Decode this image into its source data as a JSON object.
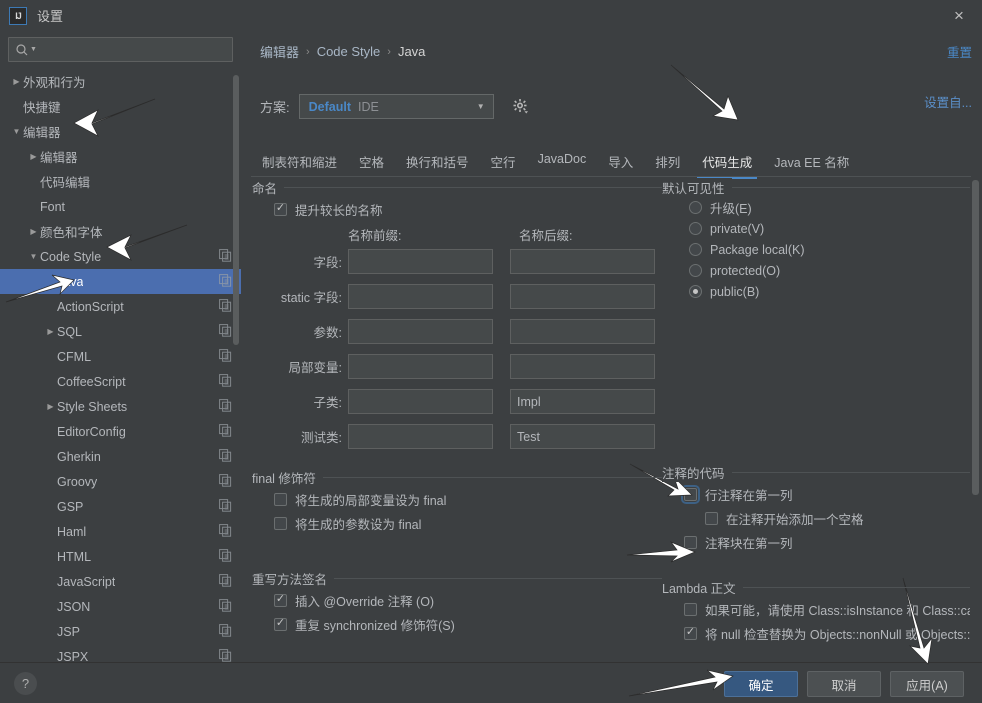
{
  "window": {
    "title": "设置",
    "logo_text": "IJ",
    "close_icon": "×"
  },
  "sidebar": {
    "search": {
      "placeholder": "",
      "value": "",
      "icon": "search-icon"
    },
    "items": [
      {
        "label": "外观和行为",
        "indent": 0,
        "twisty": "collapsed",
        "copy": false,
        "selected": false
      },
      {
        "label": "快捷键",
        "indent": 0,
        "twisty": "none",
        "copy": false,
        "selected": false
      },
      {
        "label": "编辑器",
        "indent": 0,
        "twisty": "expanded",
        "copy": false,
        "selected": false
      },
      {
        "label": "编辑器",
        "indent": 1,
        "twisty": "collapsed",
        "copy": false,
        "selected": false
      },
      {
        "label": "代码编辑",
        "indent": 1,
        "twisty": "none",
        "copy": false,
        "selected": false
      },
      {
        "label": "Font",
        "indent": 1,
        "twisty": "none",
        "copy": false,
        "selected": false
      },
      {
        "label": "颜色和字体",
        "indent": 1,
        "twisty": "collapsed",
        "copy": false,
        "selected": false
      },
      {
        "label": "Code Style",
        "indent": 1,
        "twisty": "expanded",
        "copy": true,
        "selected": false
      },
      {
        "label": "Java",
        "indent": 2,
        "twisty": "none",
        "copy": true,
        "selected": true
      },
      {
        "label": "ActionScript",
        "indent": 2,
        "twisty": "none",
        "copy": true,
        "selected": false
      },
      {
        "label": "SQL",
        "indent": 2,
        "twisty": "collapsed",
        "copy": true,
        "selected": false
      },
      {
        "label": "CFML",
        "indent": 2,
        "twisty": "none",
        "copy": true,
        "selected": false
      },
      {
        "label": "CoffeeScript",
        "indent": 2,
        "twisty": "none",
        "copy": true,
        "selected": false
      },
      {
        "label": "Style Sheets",
        "indent": 2,
        "twisty": "collapsed",
        "copy": true,
        "selected": false
      },
      {
        "label": "EditorConfig",
        "indent": 2,
        "twisty": "none",
        "copy": true,
        "selected": false
      },
      {
        "label": "Gherkin",
        "indent": 2,
        "twisty": "none",
        "copy": true,
        "selected": false
      },
      {
        "label": "Groovy",
        "indent": 2,
        "twisty": "none",
        "copy": true,
        "selected": false
      },
      {
        "label": "GSP",
        "indent": 2,
        "twisty": "none",
        "copy": true,
        "selected": false
      },
      {
        "label": "Haml",
        "indent": 2,
        "twisty": "none",
        "copy": true,
        "selected": false
      },
      {
        "label": "HTML",
        "indent": 2,
        "twisty": "none",
        "copy": true,
        "selected": false
      },
      {
        "label": "JavaScript",
        "indent": 2,
        "twisty": "none",
        "copy": true,
        "selected": false
      },
      {
        "label": "JSON",
        "indent": 2,
        "twisty": "none",
        "copy": true,
        "selected": false
      },
      {
        "label": "JSP",
        "indent": 2,
        "twisty": "none",
        "copy": true,
        "selected": false
      },
      {
        "label": "JSPX",
        "indent": 2,
        "twisty": "none",
        "copy": true,
        "selected": false
      }
    ]
  },
  "content": {
    "breadcrumb": {
      "crumb1": "编辑器",
      "crumb2": "Code Style",
      "crumb3": "Java",
      "separator": "›"
    },
    "reset_link": "重置",
    "configure_link": "设置自...",
    "scheme": {
      "label": "方案:",
      "value": "Default",
      "sub_value": "IDE",
      "arrow_icon": "chevron-down-icon",
      "gear_icon": "gear-icon"
    },
    "tabs": [
      {
        "label": "制表符和缩进",
        "active": false
      },
      {
        "label": "空格",
        "active": false
      },
      {
        "label": "换行和括号",
        "active": false
      },
      {
        "label": "空行",
        "active": false
      },
      {
        "label": "JavaDoc",
        "active": false
      },
      {
        "label": "导入",
        "active": false
      },
      {
        "label": "排列",
        "active": false
      },
      {
        "label": "代码生成",
        "active": true
      },
      {
        "label": "Java EE 名称",
        "active": false
      }
    ],
    "naming": {
      "group_title": "命名",
      "prefer_longer": {
        "label": "提升较长的名称",
        "checked": true
      },
      "col_prefix": "名称前缀:",
      "col_suffix": "名称后缀:",
      "rows": [
        {
          "label": "字段:",
          "prefix": "",
          "suffix": ""
        },
        {
          "label": "static 字段:",
          "prefix": "",
          "suffix": ""
        },
        {
          "label": "参数:",
          "prefix": "",
          "suffix": ""
        },
        {
          "label": "局部变量:",
          "prefix": "",
          "suffix": ""
        },
        {
          "label": "子类:",
          "prefix": "",
          "suffix": "Impl"
        },
        {
          "label": "测试类:",
          "prefix": "",
          "suffix": "Test"
        }
      ]
    },
    "visibility": {
      "group_title": "默认可见性",
      "options": [
        {
          "label": "升级(E)",
          "selected": false
        },
        {
          "label": "private(V)",
          "selected": false
        },
        {
          "label": "Package local(K)",
          "selected": false
        },
        {
          "label": "protected(O)",
          "selected": false
        },
        {
          "label": "public(B)",
          "selected": true
        }
      ]
    },
    "final_modifier": {
      "group_title": "final 修饰符",
      "items": [
        {
          "label": "将生成的局部变量设为 final",
          "checked": false
        },
        {
          "label": "将生成的参数设为 final",
          "checked": false
        }
      ]
    },
    "override_signature": {
      "group_title": "重写方法签名",
      "items": [
        {
          "label": "插入 @Override 注释 (O)",
          "checked": true
        },
        {
          "label": "重复 synchronized 修饰符(S)",
          "checked": true
        }
      ]
    },
    "commented_code": {
      "group_title": "注释的代码",
      "items": [
        {
          "label": "行注释在第一列",
          "checked": false,
          "focused": true,
          "indent": 0
        },
        {
          "label": "在注释开始添加一个空格",
          "checked": false,
          "focused": false,
          "indent": 1
        },
        {
          "label": "注释块在第一列",
          "checked": false,
          "focused": false,
          "indent": 0
        }
      ]
    },
    "lambda_body": {
      "group_title": "Lambda 正文",
      "items": [
        {
          "label": "如果可能，请使用 Class::isInstance 和 Class::cast",
          "checked": false
        },
        {
          "label": "将 null 检查替换为 Objects::nonNull 或 Objects::i",
          "checked": true
        }
      ]
    }
  },
  "footer": {
    "help_label": "?",
    "ok": "确定",
    "cancel": "取消",
    "apply": "应用(A)"
  },
  "colors": {
    "selection_blue": "#4b6eaf",
    "accent_blue": "#4a88c7",
    "primary_button": "#365880",
    "panel_bg": "#3c3f41",
    "field_bg": "#45494a"
  }
}
